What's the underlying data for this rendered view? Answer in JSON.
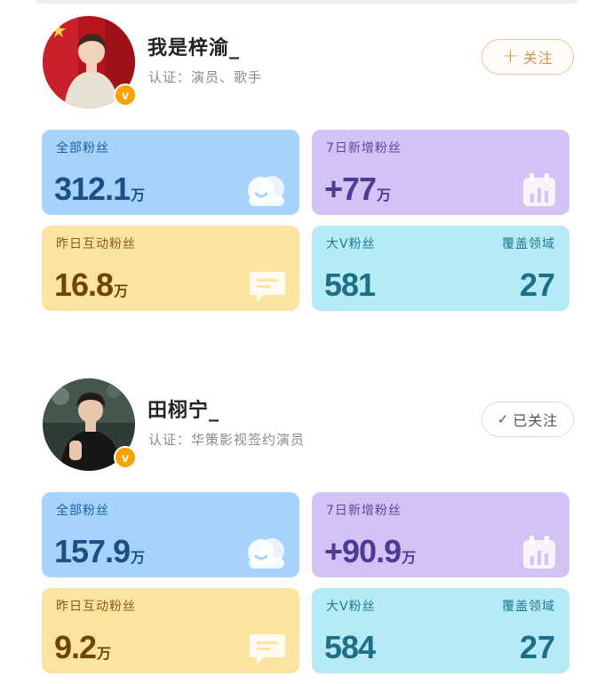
{
  "accounts": [
    {
      "name": "我是梓渝_",
      "cert": "认证：演员、歌手",
      "follow": {
        "label": "关注",
        "icon": "plus-icon",
        "followed": false
      },
      "stats": {
        "total_fans": {
          "label": "全部粉丝",
          "value": "312.1",
          "unit": "万"
        },
        "new_7d": {
          "label": "7日新增粉丝",
          "value": "+77",
          "unit": "万"
        },
        "yesterday_interact": {
          "label": "昨日互动粉丝",
          "value": "16.8",
          "unit": "万"
        },
        "big_v": {
          "label": "大V粉丝",
          "value": "581",
          "coverage_label": "覆盖领域",
          "coverage_value": "27"
        }
      }
    },
    {
      "name": "田栩宁_",
      "cert": "认证：华策影视签约演员",
      "follow": {
        "label": "已关注",
        "icon": "check-icon",
        "followed": true
      },
      "stats": {
        "total_fans": {
          "label": "全部粉丝",
          "value": "157.9",
          "unit": "万"
        },
        "new_7d": {
          "label": "7日新增粉丝",
          "value": "+90.9",
          "unit": "万"
        },
        "yesterday_interact": {
          "label": "昨日互动粉丝",
          "value": "9.2",
          "unit": "万"
        },
        "big_v": {
          "label": "大V粉丝",
          "value": "584",
          "coverage_label": "覆盖领域",
          "coverage_value": "27"
        }
      }
    }
  ],
  "badge_text": "v",
  "colors": {
    "fans_card": "#a6d3fb",
    "new_fans_card": "#d3c2f6",
    "interact_card": "#fde3a0",
    "big_v_card": "#b6eaf6",
    "verified_badge": "#f5a300",
    "follow_accent": "#d7924a"
  }
}
